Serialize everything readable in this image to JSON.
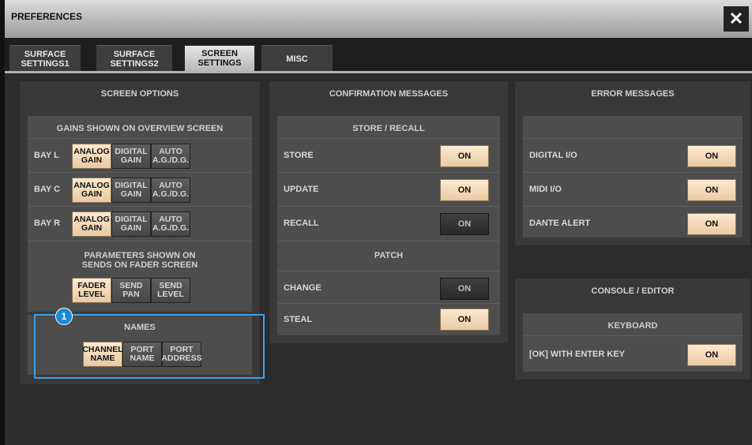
{
  "window": {
    "title": "PREFERENCES",
    "close_label": "✕"
  },
  "tabs": [
    {
      "label": "SURFACE\nSETTINGS1",
      "active": false
    },
    {
      "label": "SURFACE\nSETTINGS2",
      "active": false
    },
    {
      "label": "SCREEN\nSETTINGS",
      "active": true
    },
    {
      "label": "MISC",
      "active": false
    }
  ],
  "screen_options": {
    "title": "SCREEN OPTIONS",
    "gains": {
      "title": "GAINS SHOWN ON OVERVIEW SCREEN",
      "rows": [
        {
          "label": "BAY L",
          "buttons": [
            "ANALOG\nGAIN",
            "DIGITAL\nGAIN",
            "AUTO\nA.G./D.G."
          ],
          "selected": 0
        },
        {
          "label": "BAY C",
          "buttons": [
            "ANALOG\nGAIN",
            "DIGITAL\nGAIN",
            "AUTO\nA.G./D.G."
          ],
          "selected": 0
        },
        {
          "label": "BAY R",
          "buttons": [
            "ANALOG\nGAIN",
            "DIGITAL\nGAIN",
            "AUTO\nA.G./D.G."
          ],
          "selected": 0
        }
      ]
    },
    "parameters": {
      "title": "PARAMETERS SHOWN ON\nSENDS ON FADER SCREEN",
      "buttons": [
        "FADER\nLEVEL",
        "SEND\nPAN",
        "SEND\nLEVEL"
      ],
      "selected": 0
    },
    "names": {
      "title": "NAMES",
      "buttons": [
        "CHANNEL\nNAME",
        "PORT\nNAME",
        "PORT\nADDRESS"
      ],
      "selected": 0
    },
    "callout_number": "1"
  },
  "confirmation": {
    "title": "CONFIRMATION MESSAGES",
    "store_recall": {
      "title": "STORE / RECALL",
      "rows": [
        {
          "label": "STORE",
          "value": "ON",
          "on": true
        },
        {
          "label": "UPDATE",
          "value": "ON",
          "on": true
        },
        {
          "label": "RECALL",
          "value": "ON",
          "on": false
        }
      ]
    },
    "patch": {
      "title": "PATCH",
      "rows": [
        {
          "label": "CHANGE",
          "value": "ON",
          "on": false
        },
        {
          "label": "STEAL",
          "value": "ON",
          "on": true
        }
      ]
    }
  },
  "errors": {
    "title": "ERROR MESSAGES",
    "rows": [
      {
        "label": "DIGITAL I/O",
        "value": "ON",
        "on": true
      },
      {
        "label": "MIDI I/O",
        "value": "ON",
        "on": true
      },
      {
        "label": "DANTE ALERT",
        "value": "ON",
        "on": true
      }
    ]
  },
  "console_editor": {
    "title": "CONSOLE / EDITOR",
    "keyboard": {
      "title": "KEYBOARD",
      "rows": [
        {
          "label": "[OK] WITH ENTER KEY",
          "value": "ON",
          "on": true
        }
      ]
    }
  }
}
